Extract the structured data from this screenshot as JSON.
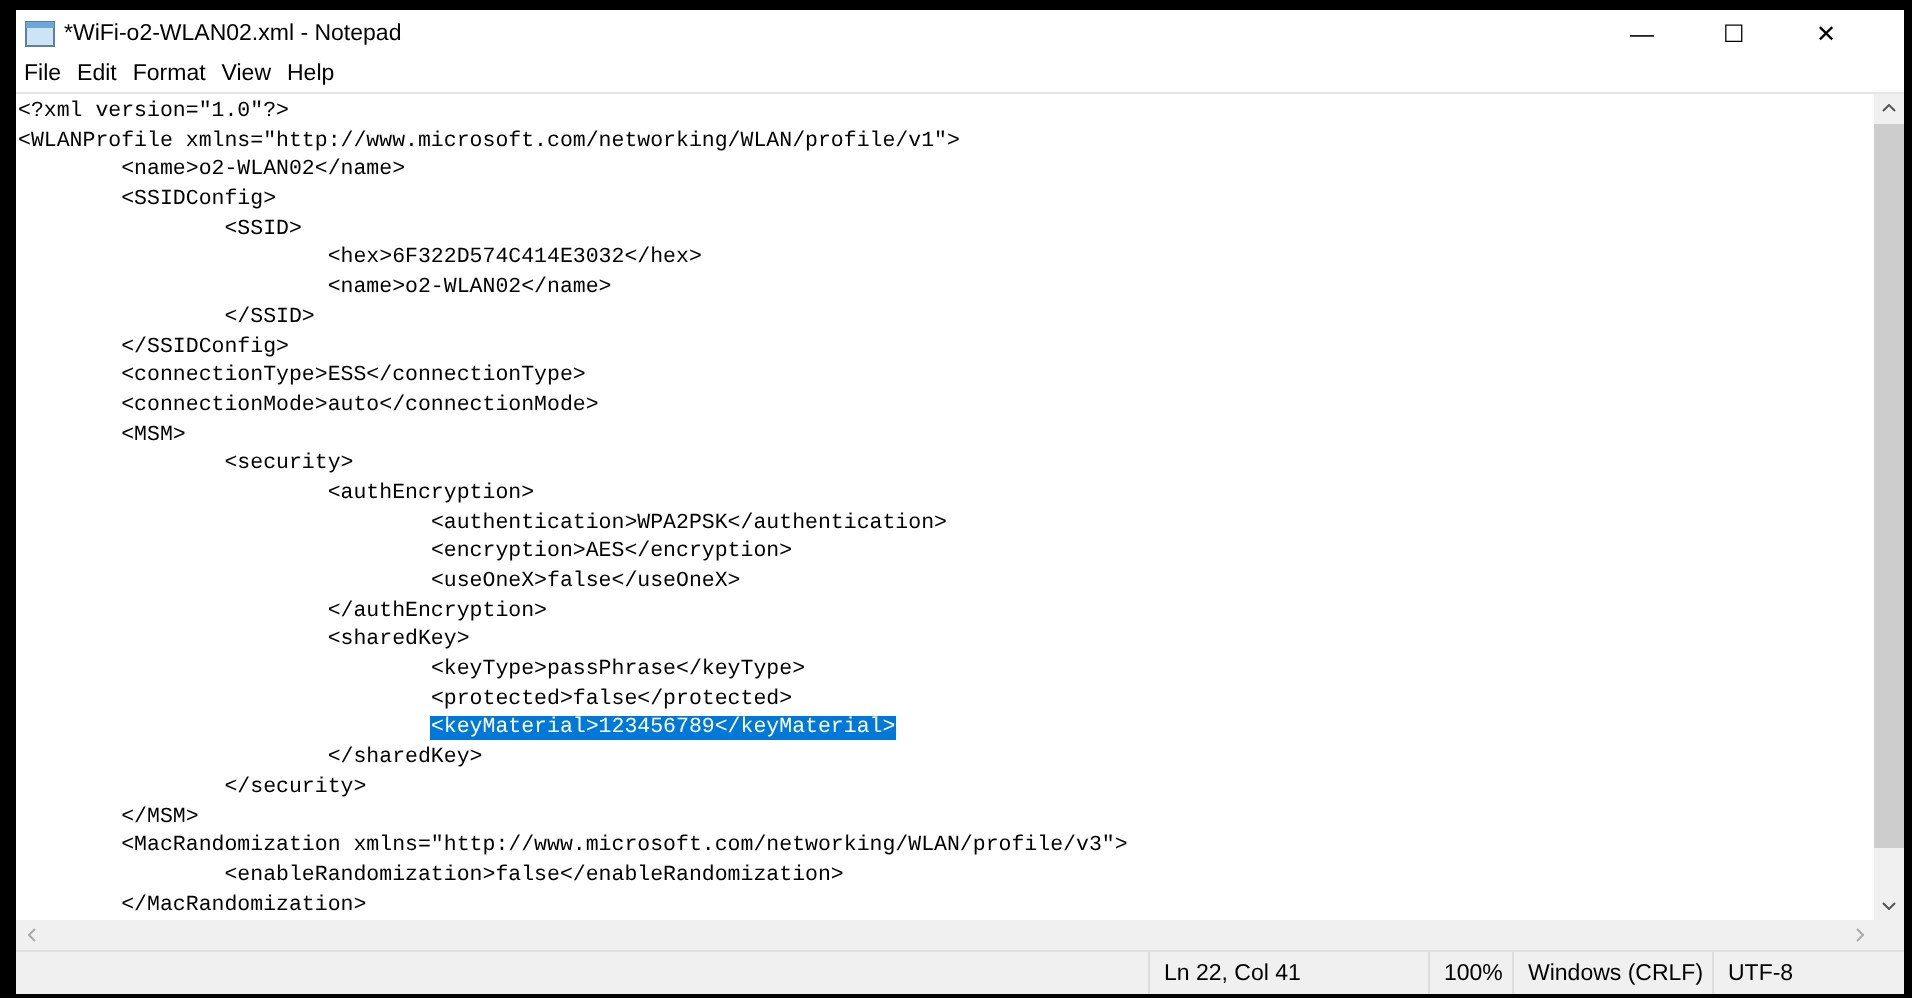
{
  "window": {
    "title": "*WiFi-o2-WLAN02.xml - Notepad",
    "controls": [
      "—",
      "☐",
      "✕"
    ]
  },
  "menu": [
    "File",
    "Edit",
    "Format",
    "View",
    "Help"
  ],
  "editor": {
    "lines": [
      {
        "text": "<?xml version=\"1.0\"?>",
        "selected": false
      },
      {
        "text": "<WLANProfile xmlns=\"http://www.microsoft.com/networking/WLAN/profile/v1\">",
        "selected": false
      },
      {
        "text": "\t<name>o2-WLAN02</name>",
        "selected": false
      },
      {
        "text": "\t<SSIDConfig>",
        "selected": false
      },
      {
        "text": "\t\t<SSID>",
        "selected": false
      },
      {
        "text": "\t\t\t<hex>6F322D574C414E3032</hex>",
        "selected": false
      },
      {
        "text": "\t\t\t<name>o2-WLAN02</name>",
        "selected": false
      },
      {
        "text": "\t\t</SSID>",
        "selected": false
      },
      {
        "text": "\t</SSIDConfig>",
        "selected": false
      },
      {
        "text": "\t<connectionType>ESS</connectionType>",
        "selected": false
      },
      {
        "text": "\t<connectionMode>auto</connectionMode>",
        "selected": false
      },
      {
        "text": "\t<MSM>",
        "selected": false
      },
      {
        "text": "\t\t<security>",
        "selected": false
      },
      {
        "text": "\t\t\t<authEncryption>",
        "selected": false
      },
      {
        "text": "\t\t\t\t<authentication>WPA2PSK</authentication>",
        "selected": false
      },
      {
        "text": "\t\t\t\t<encryption>AES</encryption>",
        "selected": false
      },
      {
        "text": "\t\t\t\t<useOneX>false</useOneX>",
        "selected": false
      },
      {
        "text": "\t\t\t</authEncryption>",
        "selected": false
      },
      {
        "text": "\t\t\t<sharedKey>",
        "selected": false
      },
      {
        "text": "\t\t\t\t<keyType>passPhrase</keyType>",
        "selected": false
      },
      {
        "text": "\t\t\t\t<protected>false</protected>",
        "selected": false
      },
      {
        "text": "\t\t\t\t<keyMaterial>123456789</keyMaterial>",
        "selected": true
      },
      {
        "text": "\t\t\t</sharedKey>",
        "selected": false
      },
      {
        "text": "\t\t</security>",
        "selected": false
      },
      {
        "text": "\t</MSM>",
        "selected": false
      },
      {
        "text": "\t<MacRandomization xmlns=\"http://www.microsoft.com/networking/WLAN/profile/v3\">",
        "selected": false
      },
      {
        "text": "\t\t<enableRandomization>false</enableRandomization>",
        "selected": false
      },
      {
        "text": "\t</MacRandomization>",
        "selected": false
      }
    ]
  },
  "status_bar": {
    "position": "Ln 22, Col 41",
    "zoom": "100%",
    "line_ending": "Windows (CRLF)",
    "encoding": "UTF-8"
  }
}
